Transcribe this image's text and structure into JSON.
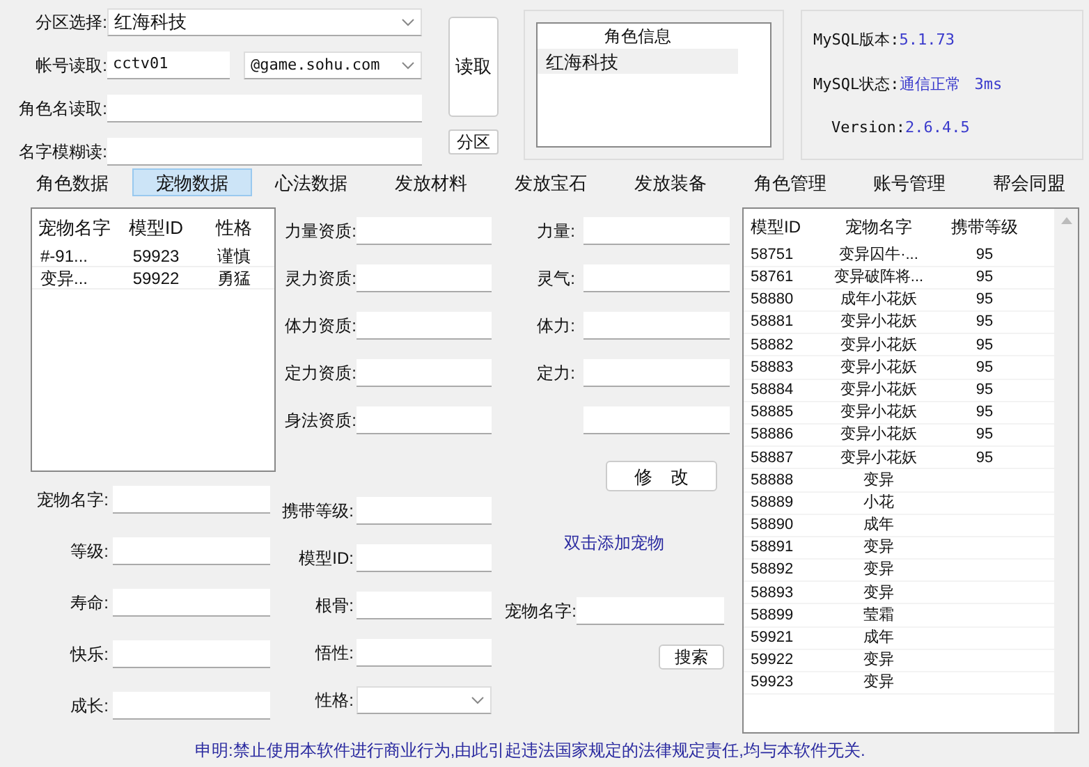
{
  "top_form": [
    {
      "kind": "select",
      "label": "分区选择:",
      "value": "红海科技"
    },
    {
      "kind": "account",
      "label": "帐号读取:",
      "value": "cctv01",
      "domain": "@game.sohu.com"
    },
    {
      "kind": "input",
      "label": "角色名读取:"
    },
    {
      "kind": "input",
      "label": "名字模糊读:"
    }
  ],
  "side_buttons": [
    {
      "kind": "tall",
      "label": "读取"
    },
    {
      "kind": "small",
      "label": "分区"
    }
  ],
  "role_info": {
    "header": "角色信息",
    "rows": [
      {
        "name": "红海科技",
        "selected": true
      }
    ]
  },
  "mysql": [
    {
      "label": "MySQL版本:",
      "value": "5.1.73"
    },
    {
      "label": "MySQL状态:",
      "value": "通信正常",
      "extra": "3ms"
    },
    {
      "label": "Version:",
      "value": "2.6.4.5"
    }
  ],
  "tabs": [
    {
      "label": "角色数据",
      "selected": false
    },
    {
      "label": "宠物数据",
      "selected": true
    },
    {
      "label": "心法数据",
      "selected": false
    },
    {
      "label": "发放材料",
      "selected": false
    },
    {
      "label": "发放宝石",
      "selected": false
    },
    {
      "label": "发放装备",
      "selected": false
    },
    {
      "label": "角色管理",
      "selected": false
    },
    {
      "label": "账号管理",
      "selected": false
    },
    {
      "label": "帮会同盟",
      "selected": false
    }
  ],
  "pet_list": {
    "columns": [
      "宠物名字",
      "模型ID",
      "性格"
    ],
    "rows": [
      {
        "name": "#-91...",
        "id": "59923",
        "nature": "谨慎"
      },
      {
        "name": "变异...",
        "id": "59922",
        "nature": "勇猛"
      }
    ]
  },
  "attributes": [
    {
      "left": "力量资质:",
      "right": "力量:"
    },
    {
      "left": "灵力资质:",
      "right": "灵气:"
    },
    {
      "left": "体力资质:",
      "right": "体力:"
    },
    {
      "left": "定力资质:",
      "right": "定力:"
    },
    {
      "left": "身法资质:"
    }
  ],
  "modify_button": "修　改",
  "pet_form": [
    "宠物名字:",
    "等级:",
    "寿命:",
    "快乐:",
    "成长:"
  ],
  "mid_form": [
    {
      "kind": "input",
      "label": "携带等级:"
    },
    {
      "kind": "input",
      "label": "模型ID:"
    },
    {
      "kind": "input",
      "label": "根骨:"
    },
    {
      "kind": "input",
      "label": "悟性:"
    },
    {
      "kind": "select",
      "label": "性格:"
    }
  ],
  "add_pet_link": "双击添加宠物",
  "search": {
    "label": "宠物名字:",
    "button": "搜索"
  },
  "pet_catalog": {
    "columns": [
      "模型ID",
      "宠物名字",
      "携带等级"
    ],
    "rows": [
      {
        "id": "58751",
        "name": "变异囚牛·...",
        "level": "95"
      },
      {
        "id": "58761",
        "name": "变异破阵将...",
        "level": "95"
      },
      {
        "id": "58880",
        "name": "成年小花妖",
        "level": "95"
      },
      {
        "id": "58881",
        "name": "变异小花妖",
        "level": "95"
      },
      {
        "id": "58882",
        "name": "变异小花妖",
        "level": "95"
      },
      {
        "id": "58883",
        "name": "变异小花妖",
        "level": "95"
      },
      {
        "id": "58884",
        "name": "变异小花妖",
        "level": "95"
      },
      {
        "id": "58885",
        "name": "变异小花妖",
        "level": "95"
      },
      {
        "id": "58886",
        "name": "变异小花妖",
        "level": "95"
      },
      {
        "id": "58887",
        "name": "变异小花妖",
        "level": "95"
      },
      {
        "id": "58888",
        "name": "变异"
      },
      {
        "id": "58889",
        "name": "小花"
      },
      {
        "id": "58890",
        "name": "成年"
      },
      {
        "id": "58891",
        "name": "变异"
      },
      {
        "id": "58892",
        "name": "变异"
      },
      {
        "id": "58893",
        "name": "变异"
      },
      {
        "id": "58899",
        "name": "莹霜"
      },
      {
        "id": "59921",
        "name": "成年"
      },
      {
        "id": "59922",
        "name": "变异"
      },
      {
        "id": "59923",
        "name": "变异"
      }
    ]
  },
  "notice": "申明:禁止使用本软件进行商业行为,由此引起违法国家规定的法律规定责任,均与本软件无关."
}
